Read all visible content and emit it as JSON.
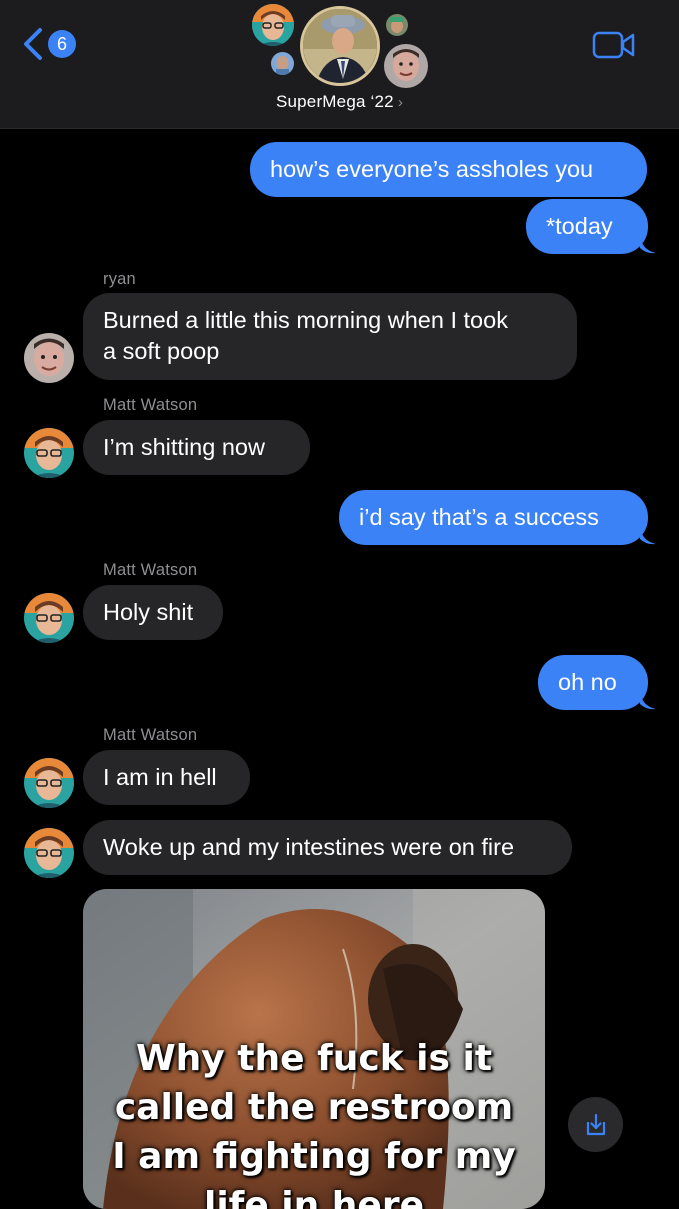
{
  "header": {
    "back_count": "6",
    "group_name": "SuperMega ‘22",
    "chevron": "›",
    "icons": [
      "chevron-left-icon",
      "video-camera-icon"
    ]
  },
  "colors": {
    "accent": "#3b82f6",
    "incoming_bubble": "#262628",
    "header_bg": "#1c1c1e",
    "secondary_text": "#8e8e93"
  },
  "messages": [
    {
      "direction": "out",
      "text": "how’s everyone’s assholes you"
    },
    {
      "direction": "out",
      "text": "*today"
    },
    {
      "direction": "in",
      "sender": "ryan",
      "lines": [
        "Burned a little this morning when I took",
        "a soft poop"
      ]
    },
    {
      "direction": "in",
      "sender": "Matt Watson",
      "text": "I’m shitting now"
    },
    {
      "direction": "out",
      "text": "i’d say that’s a success"
    },
    {
      "direction": "in",
      "sender": "Matt Watson",
      "text": "Holy shit"
    },
    {
      "direction": "out",
      "text": "oh no"
    },
    {
      "direction": "in",
      "sender": "Matt Watson",
      "text": "I am in hell"
    },
    {
      "direction": "in",
      "text": "Woke up and my intestines were on fire"
    },
    {
      "direction": "in",
      "type": "image",
      "caption_lines": [
        "Why the fuck is it",
        "called the restroom",
        "I am fighting for my",
        "life in here"
      ]
    }
  ],
  "image_actions": {
    "save_icon": "download-icon"
  }
}
